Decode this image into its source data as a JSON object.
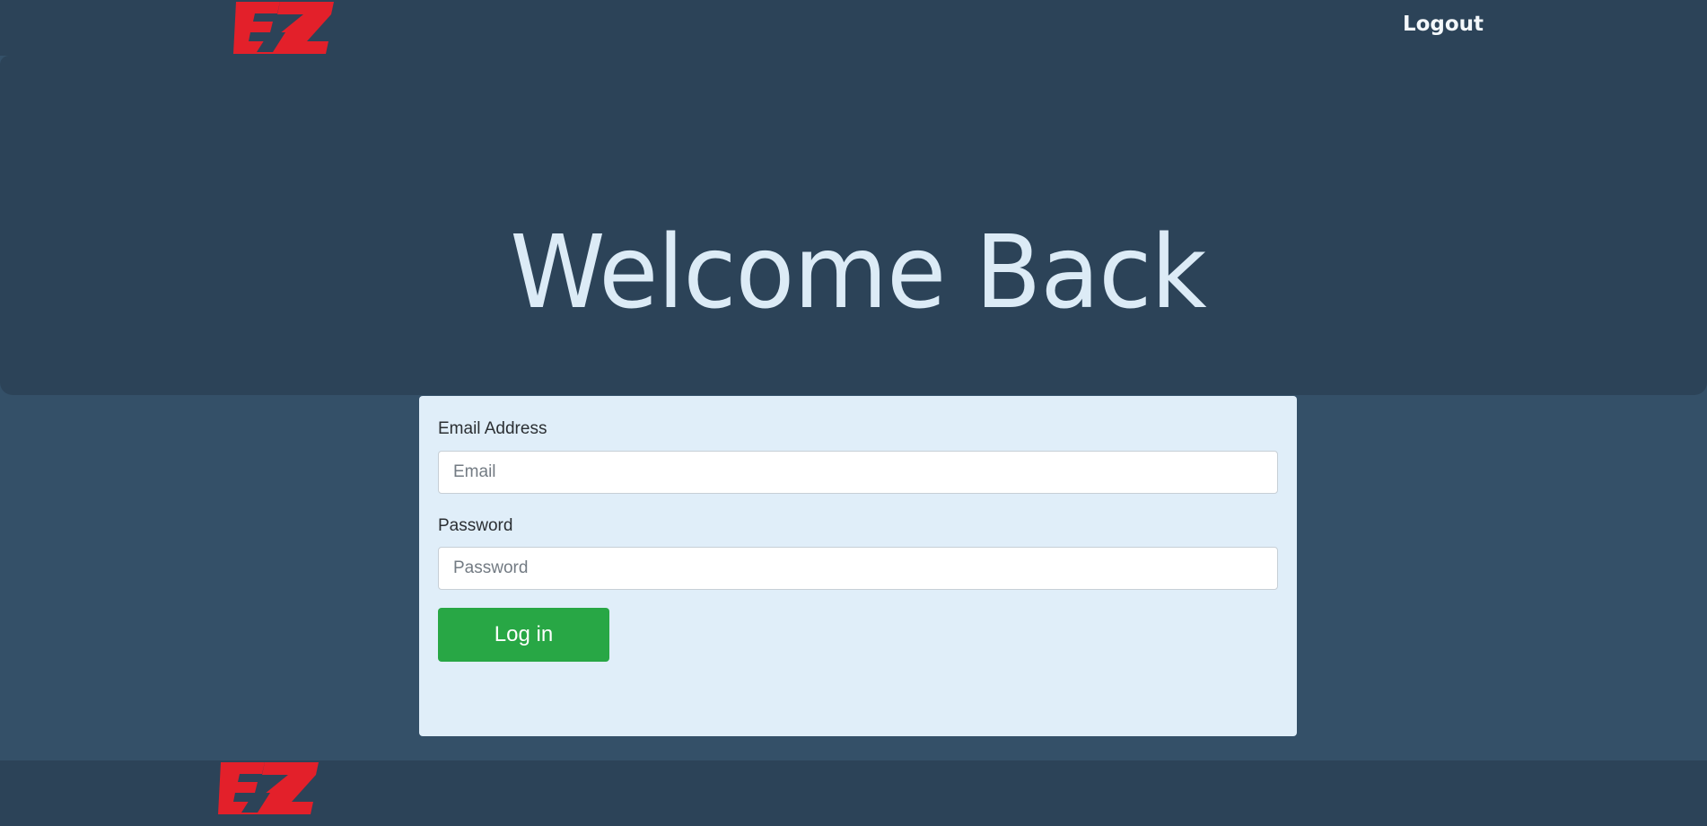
{
  "navbar": {
    "logo_icon": "ez-logo-icon",
    "logout_label": "Logout"
  },
  "hero": {
    "title": "Welcome Back"
  },
  "login_form": {
    "email_label": "Email Address",
    "email_placeholder": "Email",
    "email_value": "",
    "password_label": "Password",
    "password_placeholder": "Password",
    "password_value": "",
    "submit_label": "Log in"
  },
  "footer": {
    "logo_icon": "ez-logo-icon"
  },
  "colors": {
    "brand_red": "#e3202a",
    "header_bg": "#2c4358",
    "page_bg": "#345068",
    "card_bg": "#e0eef9",
    "success_green": "#28a745",
    "hero_text": "#dcebf6"
  }
}
